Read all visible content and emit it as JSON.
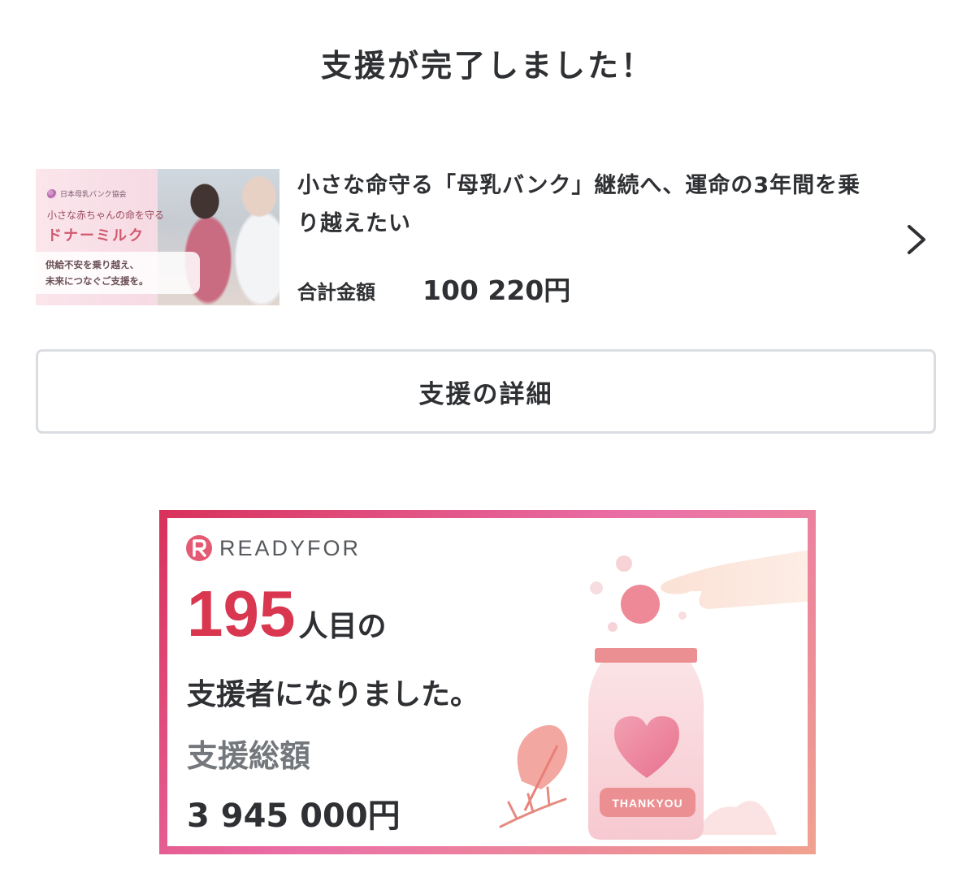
{
  "page": {
    "title": "支援が完了しました！"
  },
  "project": {
    "title": "小さな命守る「母乳バンク」継続へ、運命の3年間を乗り越えたい",
    "total_label": "合計金額",
    "total_value": "100 220円",
    "thumbnail": {
      "org": "日本母乳バンク協会",
      "tagline": "小さな赤ちゃんの命を守る",
      "headline": "ドナーミルク",
      "sub_line1": "供給不安を乗り越え、",
      "sub_line2": "未来につなぐご支援を。"
    }
  },
  "details_button": {
    "label": "支援の詳細"
  },
  "banner": {
    "brand": "READYFOR",
    "supporter_count": "195",
    "supporter_suffix": "人目の",
    "supporter_line2": "支援者になりました。",
    "total_label": "支援総額",
    "total_value": "3 945 000円",
    "jar_label": "THANKYOU"
  },
  "colors": {
    "accent": "#d9364f",
    "text": "#2e3033",
    "muted": "#74787d",
    "border": "#d9dde2"
  },
  "icons": {
    "chevron": "chevron-right-icon",
    "brand_logo": "readyfor-logo-icon",
    "heart": "heart-icon"
  }
}
